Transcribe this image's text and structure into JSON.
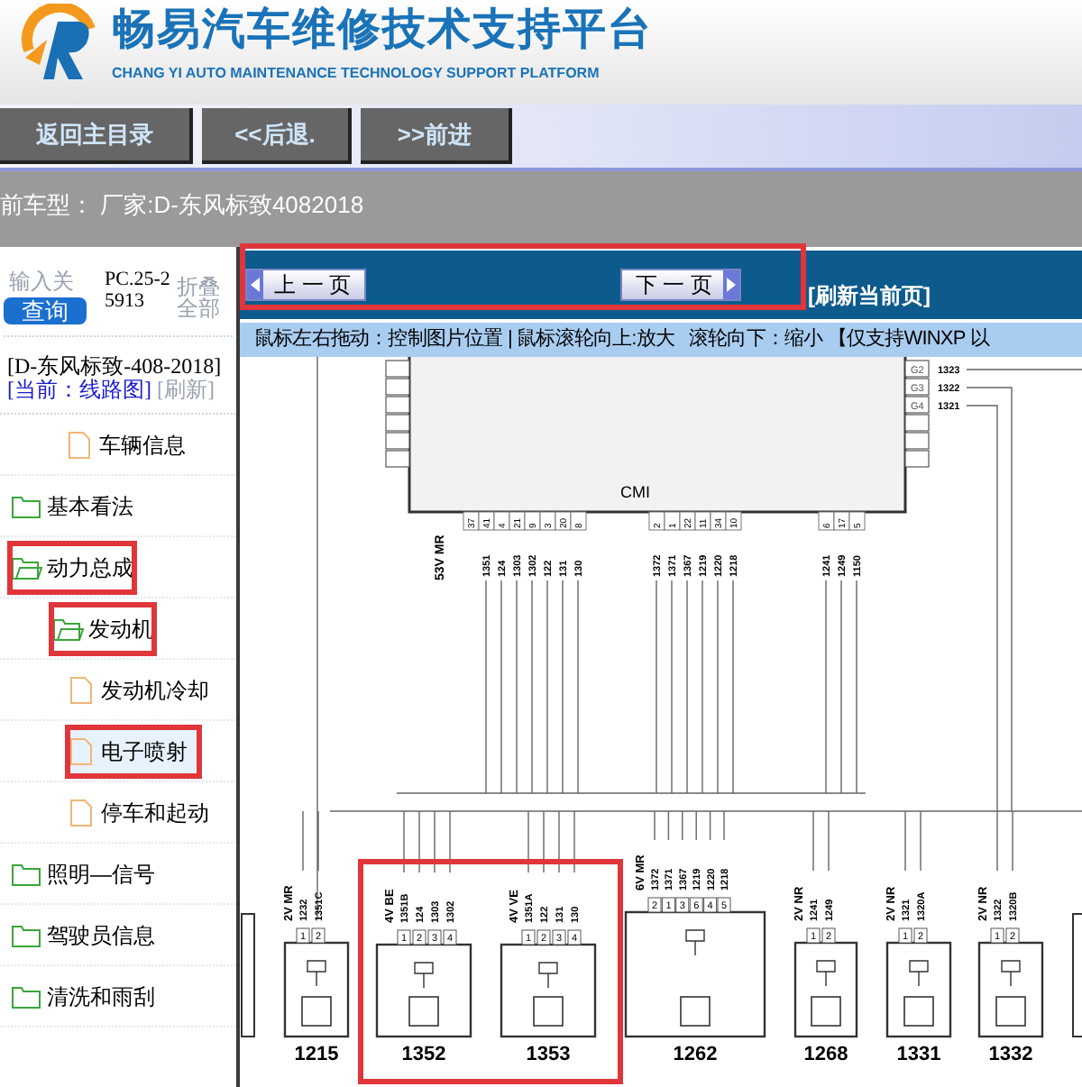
{
  "header": {
    "title": "畅易汽车维修技术支持平台",
    "subtitle": "CHANG YI AUTO MAINTENANCE TECHNOLOGY SUPPORT PLATFORM"
  },
  "nav_buttons": [
    "返回主目录",
    "<<后退.",
    ">>前进"
  ],
  "vehicle_bar": "前车型： 厂家:D-东风标致4082018",
  "sidebar": {
    "search_label": "输入关",
    "search_button": "查询",
    "code": "PC.25-25913",
    "collapse_all": "折叠全部",
    "vehicle": "[D-东风标致-408-2018]",
    "current": "[当前：线路图]",
    "refresh": "[刷新]",
    "tree": [
      {
        "label": "车辆信息",
        "kind": "file",
        "selected": false,
        "highlighted": false
      },
      {
        "label": "基本看法",
        "kind": "folder",
        "expanded": false,
        "selected": false,
        "highlighted": false
      },
      {
        "label": "动力总成",
        "kind": "folder",
        "expanded": true,
        "selected": false,
        "highlighted": true,
        "children": [
          {
            "label": "发动机",
            "kind": "folder",
            "expanded": true,
            "selected": false,
            "highlighted": true,
            "children": [
              {
                "label": "发动机冷却",
                "kind": "file",
                "selected": false,
                "highlighted": false
              },
              {
                "label": "电子喷射",
                "kind": "file",
                "selected": true,
                "highlighted": true
              },
              {
                "label": "停车和起动",
                "kind": "file",
                "selected": false,
                "highlighted": false
              }
            ]
          }
        ]
      },
      {
        "label": "照明—信号",
        "kind": "folder",
        "expanded": false,
        "selected": false,
        "highlighted": false
      },
      {
        "label": "驾驶员信息",
        "kind": "folder",
        "expanded": false,
        "selected": false,
        "highlighted": false
      },
      {
        "label": "清洗和雨刮",
        "kind": "folder",
        "expanded": false,
        "selected": false,
        "highlighted": false
      }
    ]
  },
  "toolbar": {
    "prev": "上 一 页",
    "next": "下 一 页",
    "refresh": "[刷新当前页]",
    "highlighted": true
  },
  "hint": "鼠标左右拖动：控制图片位置 | 鼠标滚轮向上:放大   滚轮向下：缩小 【仅支持WINXP 以",
  "diagram": {
    "module": "CMI",
    "module_connector": "53V MR",
    "side_pins": [
      {
        "pin": "G2",
        "wire": "1323"
      },
      {
        "pin": "G3",
        "wire": "1322"
      },
      {
        "pin": "G4",
        "wire": "1321"
      }
    ],
    "pin_groups": [
      {
        "pins": [
          "37",
          "41",
          "4",
          "21",
          "9",
          "3",
          "20",
          "8"
        ],
        "wires": [
          "1351",
          "124",
          "1303",
          "1302",
          "122",
          "131",
          "130"
        ]
      },
      {
        "pins": [
          "2",
          "1",
          "22",
          "11",
          "34",
          "10"
        ],
        "wires": [
          "1372",
          "1371",
          "1367",
          "1219",
          "1220",
          "1218"
        ]
      },
      {
        "pins": [
          "6",
          "17",
          "5"
        ],
        "wires": [
          "1241",
          "1249",
          "1150"
        ]
      }
    ],
    "component_groups": [
      {
        "highlighted": false,
        "components": [
          {
            "number": "1215",
            "connector": "2V MR",
            "pins": [
              "1",
              "2"
            ],
            "wires": [
              "1232",
              "1351C"
            ]
          }
        ]
      },
      {
        "highlighted": true,
        "components": [
          {
            "number": "1352",
            "connector": "4V BE",
            "pins": [
              "1",
              "2",
              "3",
              "4"
            ],
            "wires": [
              "1351B",
              "124",
              "1303",
              "1302"
            ]
          },
          {
            "number": "1353",
            "connector": "4V VE",
            "pins": [
              "1",
              "2",
              "3",
              "4"
            ],
            "wires": [
              "1351A",
              "122",
              "131",
              "130"
            ]
          }
        ]
      },
      {
        "highlighted": false,
        "components": [
          {
            "number": "1262",
            "connector": "6V MR",
            "pins": [
              "2",
              "1",
              "3",
              "6",
              "4",
              "5"
            ],
            "wires": [
              "1372",
              "1371",
              "1367",
              "1219",
              "1220",
              "1218"
            ]
          }
        ]
      },
      {
        "highlighted": false,
        "components": [
          {
            "number": "1268",
            "connector": "2V NR",
            "pins": [
              "1",
              "2"
            ],
            "wires": [
              "1241",
              "1249"
            ]
          }
        ]
      },
      {
        "highlighted": false,
        "components": [
          {
            "number": "1331",
            "connector": "2V NR",
            "pins": [
              "1",
              "2"
            ],
            "wires": [
              "1321",
              "1320A"
            ]
          }
        ]
      },
      {
        "highlighted": false,
        "components": [
          {
            "number": "1332",
            "connector": "2V NR",
            "pins": [
              "1",
              "2"
            ],
            "wires": [
              "1322",
              "1320B"
            ]
          }
        ]
      }
    ]
  }
}
